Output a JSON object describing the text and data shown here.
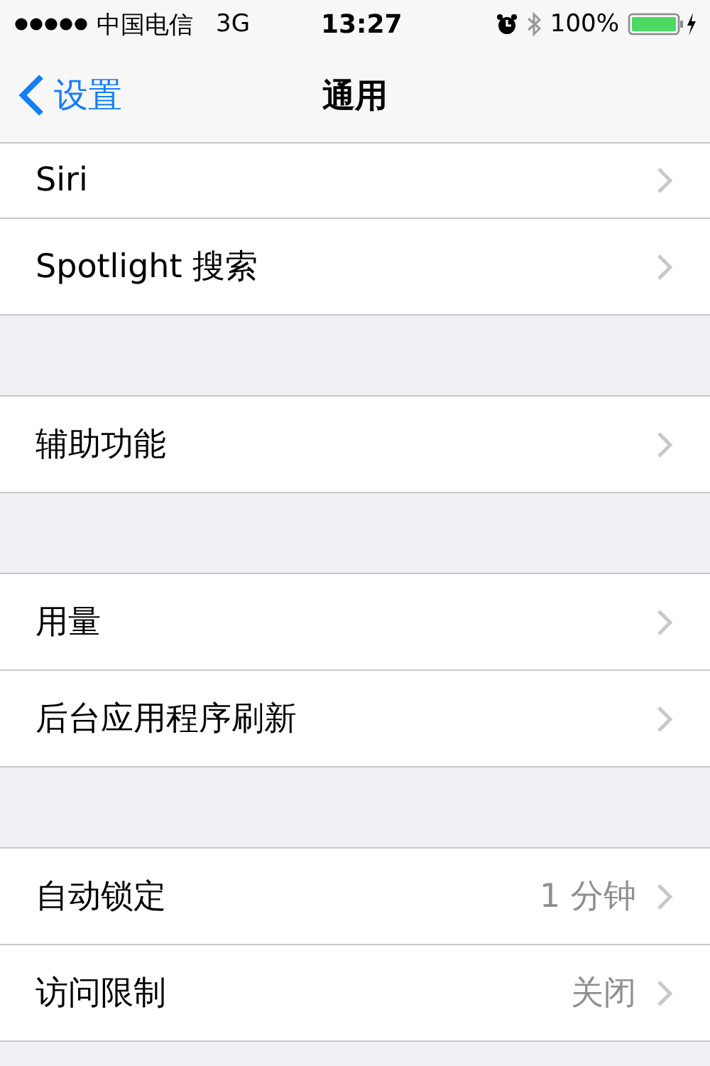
{
  "status_bar": {
    "carrier": "中国电信",
    "network": "3G",
    "time": "13:27",
    "battery": "100%"
  },
  "nav": {
    "back": "设置",
    "title": "通用"
  },
  "groups": [
    {
      "rows": [
        {
          "label": "Siri"
        },
        {
          "label": "Spotlight 搜索"
        }
      ]
    },
    {
      "rows": [
        {
          "label": "辅助功能"
        }
      ]
    },
    {
      "rows": [
        {
          "label": "用量"
        },
        {
          "label": "后台应用程序刷新"
        }
      ]
    },
    {
      "rows": [
        {
          "label": "自动锁定",
          "value": "1 分钟"
        },
        {
          "label": "访问限制",
          "value": "关闭"
        }
      ]
    }
  ]
}
